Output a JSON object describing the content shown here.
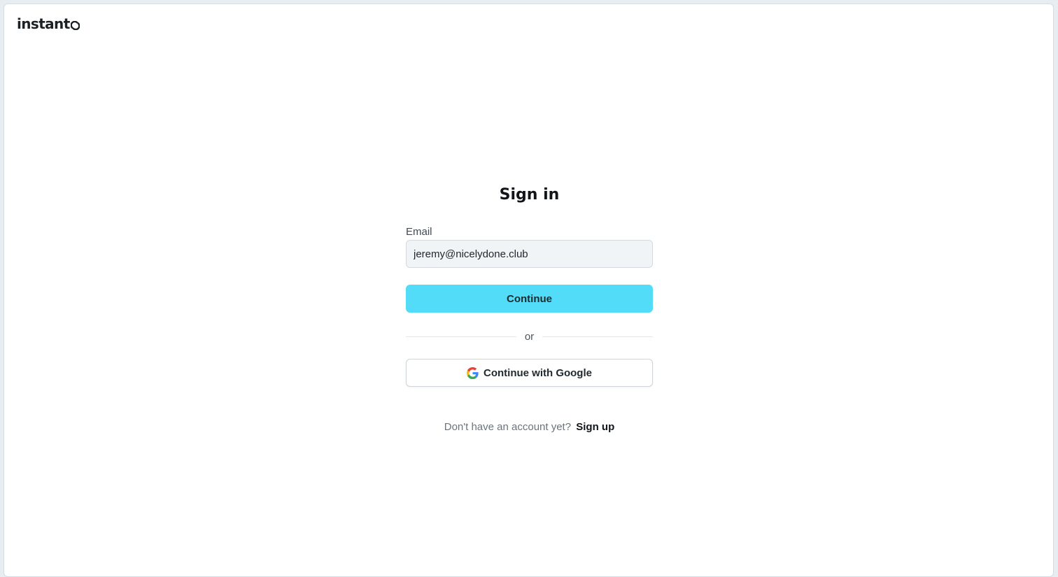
{
  "brand": {
    "name": "instant",
    "mark_icon": "instant-logo-mark-icon"
  },
  "signin": {
    "title": "Sign in",
    "email_label": "Email",
    "email_value": "jeremy@nicelydone.club",
    "continue_label": "Continue",
    "divider_text": "or",
    "google_label": "Continue with Google",
    "google_icon": "google-g-icon",
    "signup_prompt": "Don't have an account yet?",
    "signup_link": "Sign up"
  },
  "colors": {
    "accent": "#52dcf8",
    "input_bg": "#f1f4f6",
    "text_primary": "#111418",
    "text_muted": "#6b737b"
  }
}
